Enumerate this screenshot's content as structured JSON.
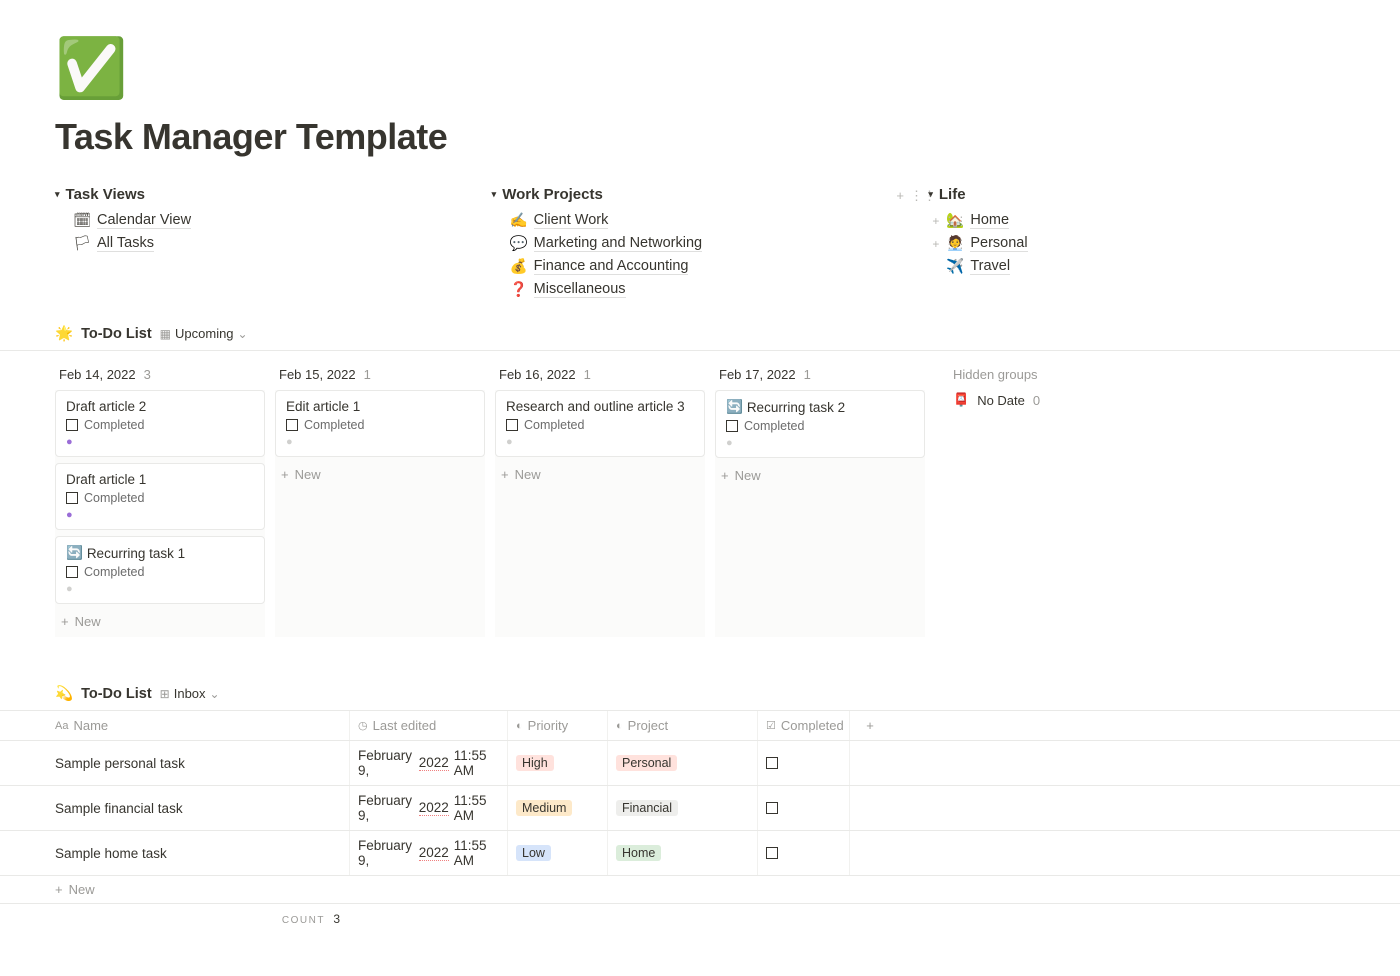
{
  "page": {
    "icon": "✅",
    "title": "Task Manager Template"
  },
  "nav": {
    "task_views": {
      "title": "Task Views",
      "items": [
        {
          "icon": "🗓",
          "label": "Calendar View"
        },
        {
          "icon": "🏳",
          "label": "All Tasks"
        }
      ]
    },
    "work_projects": {
      "title": "Work Projects",
      "items": [
        {
          "icon": "✍️",
          "label": "Client Work"
        },
        {
          "icon": "💬",
          "label": "Marketing and Networking"
        },
        {
          "icon": "💰",
          "label": "Finance and Accounting"
        },
        {
          "icon": "❓",
          "label": "Miscellaneous"
        }
      ]
    },
    "life": {
      "title": "Life",
      "items": [
        {
          "icon": "🏡",
          "label": "Home"
        },
        {
          "icon": "🧑‍💼",
          "label": "Personal"
        },
        {
          "icon": "✈️",
          "label": "Travel"
        }
      ]
    }
  },
  "board": {
    "section_icon": "🌟",
    "section_title": "To-Do List",
    "view_name": "Upcoming",
    "hidden_label": "Hidden groups",
    "no_date_label": "No Date",
    "no_date_count": "0",
    "new_label": "New",
    "completed_label": "Completed",
    "columns": [
      {
        "date": "Feb 14, 2022",
        "count": "3",
        "cards": [
          {
            "icon": "",
            "title": "Draft article 2",
            "dot": "purple"
          },
          {
            "icon": "",
            "title": "Draft article 1",
            "dot": "purple"
          },
          {
            "icon": "🔄",
            "title": "Recurring task 1",
            "dot": "gray"
          }
        ]
      },
      {
        "date": "Feb 15, 2022",
        "count": "1",
        "cards": [
          {
            "icon": "",
            "title": "Edit article 1",
            "dot": "gray"
          }
        ]
      },
      {
        "date": "Feb 16, 2022",
        "count": "1",
        "cards": [
          {
            "icon": "",
            "title": "Research and outline article 3",
            "dot": "gray"
          }
        ]
      },
      {
        "date": "Feb 17, 2022",
        "count": "1",
        "cards": [
          {
            "icon": "🔄",
            "title": "Recurring task 2",
            "dot": "gray"
          }
        ]
      }
    ]
  },
  "table": {
    "section_icon": "💫",
    "section_title": "To-Do List",
    "view_name": "Inbox",
    "new_label": "New",
    "headers": {
      "name": "Name",
      "last_edited": "Last edited",
      "priority": "Priority",
      "project": "Project",
      "completed": "Completed"
    },
    "rows": [
      {
        "name": "Sample personal task",
        "edited_prefix": "February 9, ",
        "edited_year": "2022",
        "edited_suffix": " 11:55 AM",
        "priority": "High",
        "priority_class": "prio-high",
        "project": "Personal",
        "project_class": "proj-personal"
      },
      {
        "name": "Sample financial task",
        "edited_prefix": "February 9, ",
        "edited_year": "2022",
        "edited_suffix": " 11:55 AM",
        "priority": "Medium",
        "priority_class": "prio-medium",
        "project": "Financial",
        "project_class": "proj-financial"
      },
      {
        "name": "Sample home task",
        "edited_prefix": "February 9, ",
        "edited_year": "2022",
        "edited_suffix": " 11:55 AM",
        "priority": "Low",
        "priority_class": "prio-low",
        "project": "Home",
        "project_class": "proj-home"
      }
    ],
    "footer_label": "COUNT",
    "footer_count": "3"
  }
}
